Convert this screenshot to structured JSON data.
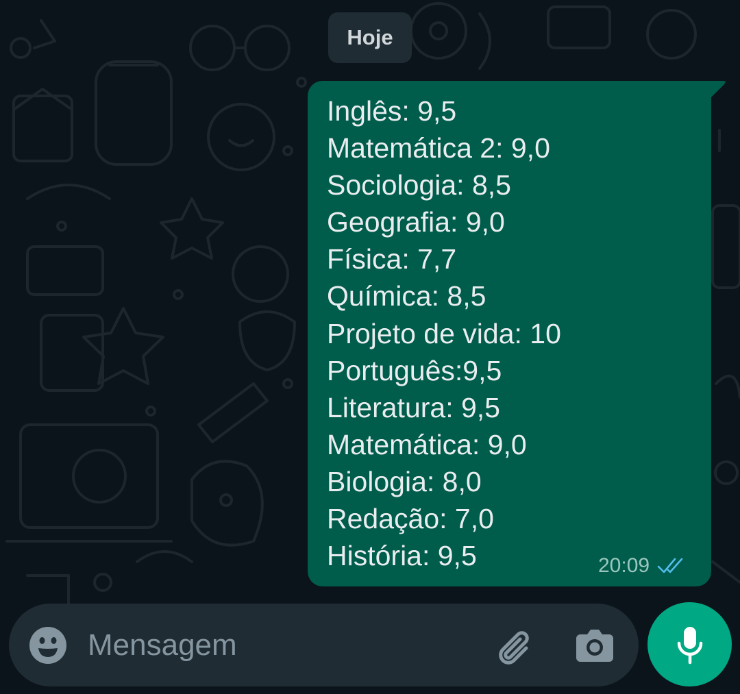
{
  "date_chip": {
    "label": "Hoje"
  },
  "message": {
    "lines": [
      "Inglês: 9,5",
      "Matemática 2: 9,0",
      "Sociologia: 8,5",
      "Geografia: 9,0",
      "Física: 7,7",
      "Química: 8,5",
      "Projeto de vida: 10",
      "Português:9,5",
      "Literatura: 9,5",
      "Matemática: 9,0",
      "Biologia: 8,0",
      "Redação: 7,0",
      "História: 9,5"
    ],
    "time": "20:09",
    "status_icon": "double-check-read-icon",
    "bubble_color": "#005c4b",
    "check_color": "#53bdeb"
  },
  "composer": {
    "placeholder": "Mensagem",
    "emoji_icon": "emoji-icon",
    "attach_icon": "paperclip-icon",
    "camera_icon": "camera-icon",
    "mic_icon": "microphone-icon",
    "mic_button_color": "#00a884"
  },
  "theme": {
    "background": "#0b141a",
    "surface": "#1f2c33"
  }
}
